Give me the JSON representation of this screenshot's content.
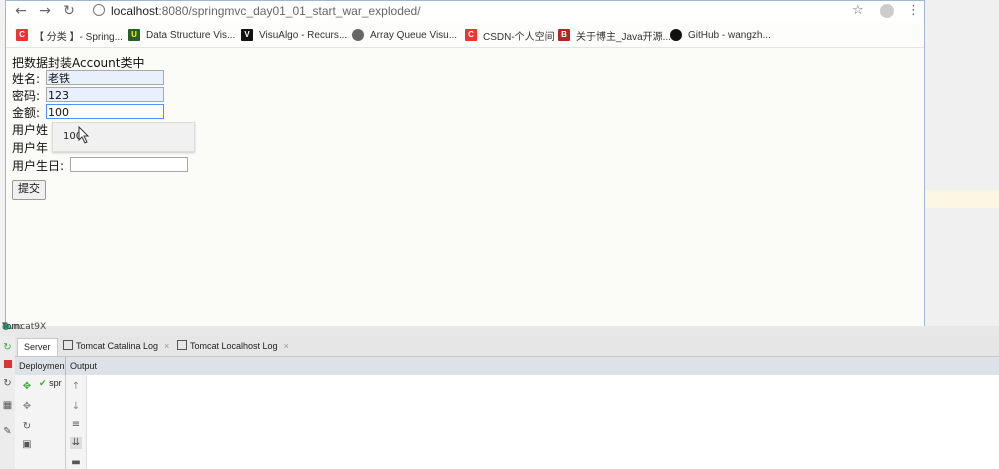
{
  "browser": {
    "nav": {
      "back": "←",
      "forward": "→",
      "reload": "↻"
    },
    "url_host": "localhost",
    "url_path": ":8080/springmvc_day01_01_start_war_exploded/",
    "star": "☆",
    "menu": "⋮"
  },
  "bookmarks": [
    {
      "icon": "csdn-icon",
      "label": "【 分类 】- Spring...",
      "color": "#e33"
    },
    {
      "icon": "usf-icon",
      "label": "Data Structure Vis...",
      "color": "#2a5d2a"
    },
    {
      "icon": "visualgo-icon",
      "label": "VisuAlgo - Recurs...",
      "color": "#111"
    },
    {
      "icon": "globe-icon",
      "label": "Array Queue Visu...",
      "color": "#666"
    },
    {
      "icon": "csdn-icon",
      "label": "CSDN-个人空间",
      "color": "#e33"
    },
    {
      "icon": "blog-b-icon",
      "label": "关于博主_Java开源...",
      "color": "#b22"
    },
    {
      "icon": "github-icon",
      "label": "GitHub - wangzh...",
      "color": "#111"
    }
  ],
  "form": {
    "title": "把数据封装Account类中",
    "name_label": "姓名:",
    "name_value": "老铁",
    "password_label": "密码:",
    "password_value": "123",
    "money_label": "金额:",
    "money_value": "100",
    "user_name_label": "用户姓",
    "user_age_label": "用户年",
    "user_birthday_label": "用户生日:",
    "autocomplete_option": "100",
    "submit_label": "提交"
  },
  "ide": {
    "run_label": "Run:",
    "run_config": "Tomcat9X",
    "tabs": [
      {
        "label": "Server"
      },
      {
        "label": "Tomcat Catalina Log"
      },
      {
        "label": "Tomcat Localhost Log"
      }
    ],
    "tab_close": "×",
    "deployment_label": "Deploymen",
    "output_label": "Output",
    "deploy_item": "spr"
  }
}
